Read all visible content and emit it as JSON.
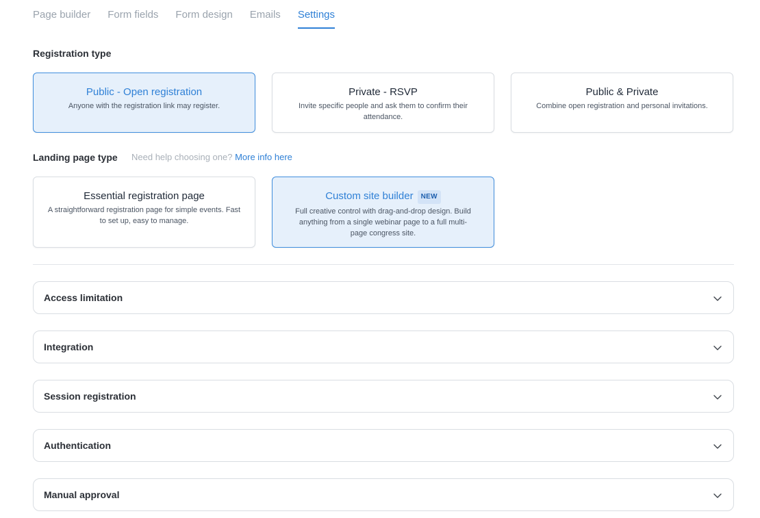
{
  "tabs": [
    {
      "label": "Page builder",
      "active": false
    },
    {
      "label": "Form fields",
      "active": false
    },
    {
      "label": "Form design",
      "active": false
    },
    {
      "label": "Emails",
      "active": false
    },
    {
      "label": "Settings",
      "active": true
    }
  ],
  "registration": {
    "label": "Registration type",
    "options": [
      {
        "title": "Public - Open registration",
        "description": "Anyone with the registration link may register.",
        "selected": true
      },
      {
        "title": "Private - RSVP",
        "description": "Invite specific people and ask them to confirm their attendance.",
        "selected": false
      },
      {
        "title": "Public & Private",
        "description": "Combine open registration and personal invitations.",
        "selected": false
      }
    ]
  },
  "landing": {
    "label": "Landing page type",
    "hint": "Need help choosing one?",
    "hint_link": "More info here",
    "options": [
      {
        "title": "Essential registration page",
        "description": "A straightforward registration page for simple events. Fast to set up, easy to manage.",
        "selected": false
      },
      {
        "title": "Custom site builder",
        "badge": "NEW",
        "description": "Full creative control with drag-and-drop design. Build anything from a single webinar page to a full multi-page congress site.",
        "selected": true
      }
    ]
  },
  "accordions": [
    {
      "title": "Access limitation"
    },
    {
      "title": "Integration"
    },
    {
      "title": "Session registration"
    },
    {
      "title": "Authentication"
    },
    {
      "title": "Manual approval"
    }
  ],
  "colors": {
    "accent": "#2f80d6",
    "selected_bg": "#e6f0fb",
    "border": "#d9dde2"
  },
  "icons": {
    "accordion": "chevron-down-icon"
  }
}
